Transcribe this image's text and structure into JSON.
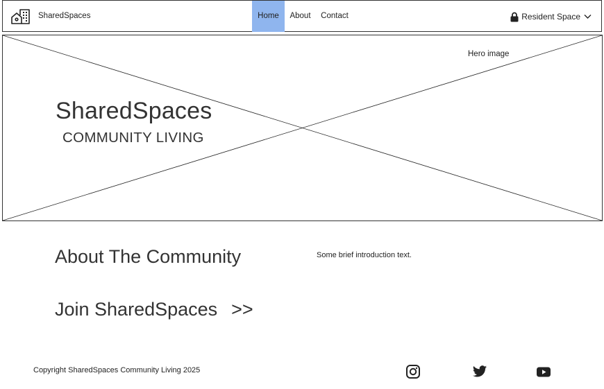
{
  "header": {
    "brand": "SharedSpaces",
    "nav": [
      {
        "label": "Home",
        "active": true
      },
      {
        "label": "About",
        "active": false
      },
      {
        "label": "Contact",
        "active": false
      }
    ],
    "resident_space": "Resident Space",
    "active_color": "#8fb5ee"
  },
  "hero": {
    "caption": "Hero image",
    "title": "SharedSpaces",
    "subtitle": "COMMUNITY LIVING"
  },
  "main": {
    "about_heading": "About The Community",
    "intro_text": "Some brief introduction text.",
    "join_label": "Join SharedSpaces",
    "join_arrows": ">>"
  },
  "footer": {
    "copyright": "Copyright SharedSpaces Community Living 2025",
    "social_icons": [
      "instagram-icon",
      "twitter-icon",
      "youtube-icon"
    ]
  }
}
